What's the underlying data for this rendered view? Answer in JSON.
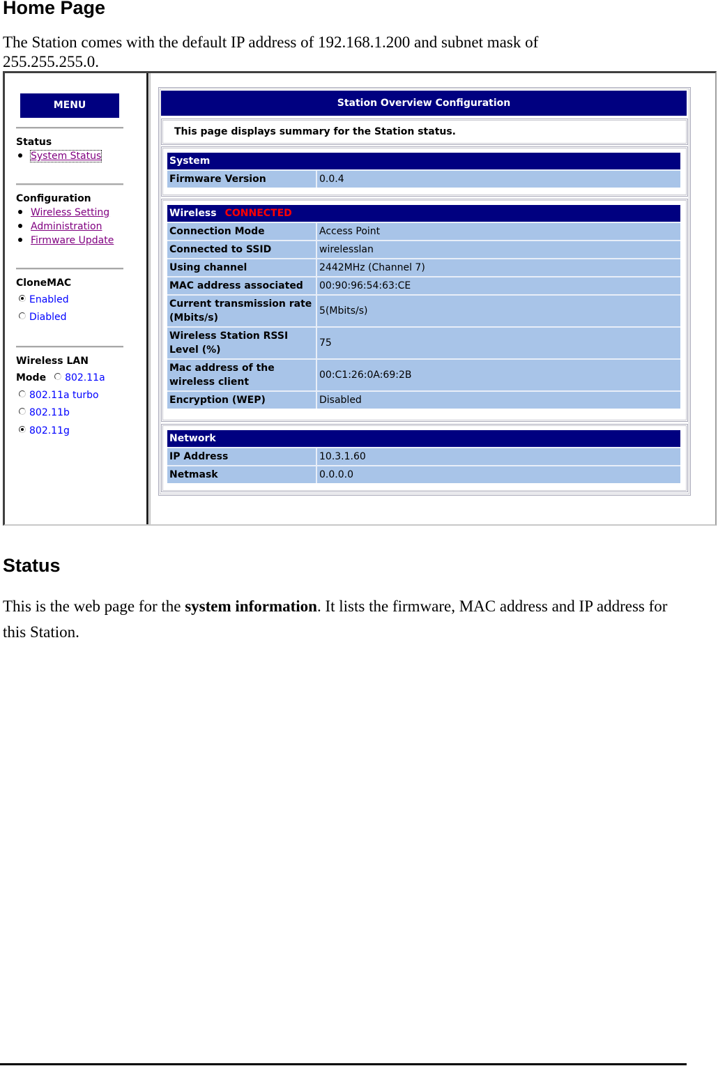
{
  "doc": {
    "heading": "Home Page",
    "intro": "The Station comes with the default IP address of 192.168.1.200 and subnet mask of 255.255.255.0.",
    "status_heading": "Status",
    "status_text_pre": "This is the web page for the ",
    "status_text_bold": "system information",
    "status_text_post": ". It lists the firmware, MAC address and IP address for this Station."
  },
  "sidebar": {
    "menu_label": "MENU",
    "status_title": "Status",
    "status_items": [
      "System Status"
    ],
    "config_title": "Configuration",
    "config_items": [
      "Wireless Setting",
      "Administration",
      "Firmware Update"
    ],
    "clonemac_title": "CloneMAC",
    "clonemac_options": [
      {
        "label": "Enabled",
        "selected": true
      },
      {
        "label": "Diabled",
        "selected": false
      }
    ],
    "wlan_title": "Wireless LAN",
    "wlan_mode_label": "Mode",
    "wlan_options": [
      {
        "label": "802.11a",
        "selected": false
      },
      {
        "label": "802.11a turbo",
        "selected": false
      },
      {
        "label": "802.11b",
        "selected": false
      },
      {
        "label": "802.11g",
        "selected": true
      }
    ]
  },
  "main": {
    "title": "Station Overview Configuration",
    "description": "This page displays summary for the Station status.",
    "system": {
      "header": "System",
      "rows": [
        {
          "key": "Firmware Version",
          "value": "0.0.4"
        }
      ]
    },
    "wireless": {
      "header": "Wireless",
      "status": "CONNECTED",
      "rows": [
        {
          "key": "Connection Mode",
          "value": "Access Point"
        },
        {
          "key": "Connected to SSID",
          "value": "wirelesslan"
        },
        {
          "key": "Using channel",
          "value": "2442MHz (Channel 7)"
        },
        {
          "key": "MAC address associated",
          "value": "00:90:96:54:63:CE"
        },
        {
          "key": "Current transmission rate (Mbits/s)",
          "value": "5(Mbits/s)"
        },
        {
          "key": "Wireless Station RSSI Level (%)",
          "value": "75"
        },
        {
          "key": "Mac address of the wireless client",
          "value": "00:C1:26:0A:69:2B"
        },
        {
          "key": "Encryption (WEP)",
          "value": "Disabled"
        }
      ]
    },
    "network": {
      "header": "Network",
      "rows": [
        {
          "key": "IP Address",
          "value": "10.3.1.60"
        },
        {
          "key": "Netmask",
          "value": "0.0.0.0"
        }
      ]
    }
  },
  "colors": {
    "header_bg": "#000080",
    "row_bg": "#a8c4e8",
    "connected": "#ff0000",
    "visited_link": "#800080",
    "radio_label": "#0000ff"
  }
}
